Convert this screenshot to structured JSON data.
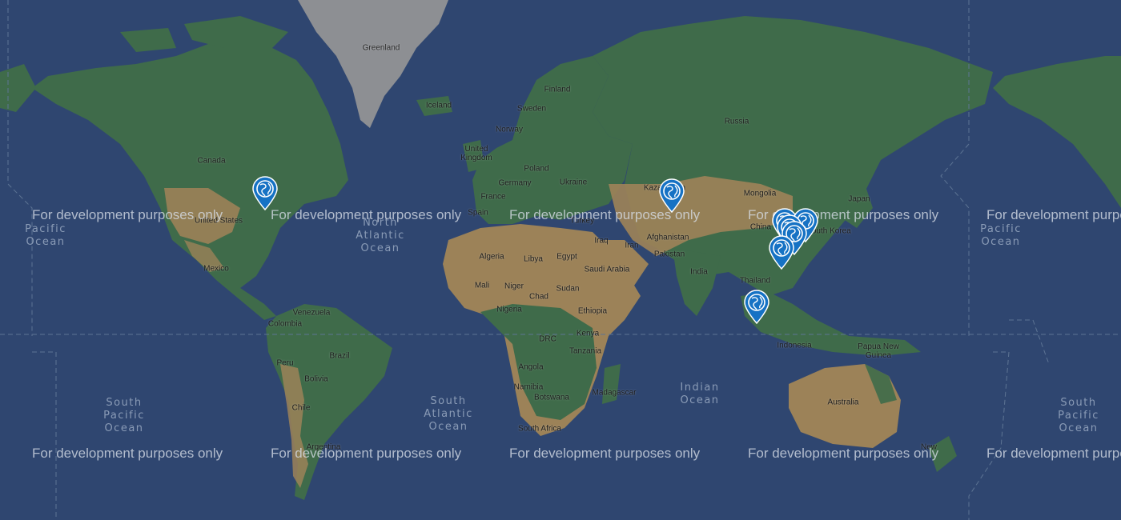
{
  "map": {
    "watermark": "For development purposes only",
    "colors": {
      "ocean": "#2f4670",
      "forest": "#3f6b4a",
      "desert": "#9c8258",
      "ice": "#8d8f93",
      "marker": "#1672c4"
    },
    "labels": {
      "greenland": "Greenland",
      "iceland": "Iceland",
      "finland": "Finland",
      "sweden": "Sweden",
      "norway": "Norway",
      "united_kingdom": "United\nKingdom",
      "poland": "Poland",
      "germany": "Germany",
      "ukraine": "Ukraine",
      "france": "France",
      "spain": "Spain",
      "turkey": "Turkey",
      "russia": "Russia",
      "kazakhstan": "Kazakhstan",
      "mongolia": "Mongolia",
      "china": "China",
      "south_korea": "South Korea",
      "japan": "Japan",
      "canada": "Canada",
      "united_states": "United States",
      "mexico": "Mexico",
      "venezuela": "Venezuela",
      "colombia": "Colombia",
      "peru": "Peru",
      "brazil": "Brazil",
      "bolivia": "Bolivia",
      "chile": "Chile",
      "argentina": "Argentina",
      "algeria": "Algeria",
      "libya": "Libya",
      "egypt": "Egypt",
      "mali": "Mali",
      "niger": "Niger",
      "chad": "Chad",
      "sudan": "Sudan",
      "nigeria": "Nigeria",
      "ethiopia": "Ethiopia",
      "kenya": "Kenya",
      "drc": "DRC",
      "tanzania": "Tanzania",
      "angola": "Angola",
      "namibia": "Namibia",
      "botswana": "Botswana",
      "madagascar": "Madagascar",
      "south_africa": "South Africa",
      "iraq": "Iraq",
      "iran": "Iran",
      "saudi_arabia": "Saudi Arabia",
      "afghanistan": "Afghanistan",
      "pakistan": "Pakistan",
      "india": "India",
      "thailand": "Thailand",
      "indonesia": "Indonesia",
      "papua_new_guinea": "Papua New\nGuinea",
      "australia": "Australia",
      "new_zealand": "New"
    },
    "oceans": {
      "north_atlantic": "North\nAtlantic\nOcean",
      "south_atlantic": "South\nAtlantic\nOcean",
      "indian": "Indian\nOcean",
      "south_pacific_left": "South\nPacific\nOcean",
      "south_pacific_right": "South\nPacific\nOcean",
      "pacific_left": "Pacific\nOcean",
      "pacific_right": "Pacific\nOcean"
    },
    "markers": [
      {
        "name": "marker-north-america",
        "icon": "globe-pin-icon"
      },
      {
        "name": "marker-kazakhstan",
        "icon": "globe-pin-icon"
      },
      {
        "name": "marker-china-1",
        "icon": "globe-pin-icon"
      },
      {
        "name": "marker-china-2",
        "icon": "globe-pin-icon"
      },
      {
        "name": "marker-china-3",
        "icon": "globe-pin-icon"
      },
      {
        "name": "marker-china-4",
        "icon": "globe-pin-icon"
      },
      {
        "name": "marker-china-south",
        "icon": "globe-pin-icon"
      },
      {
        "name": "marker-southeast-asia",
        "icon": "globe-pin-icon"
      }
    ]
  }
}
